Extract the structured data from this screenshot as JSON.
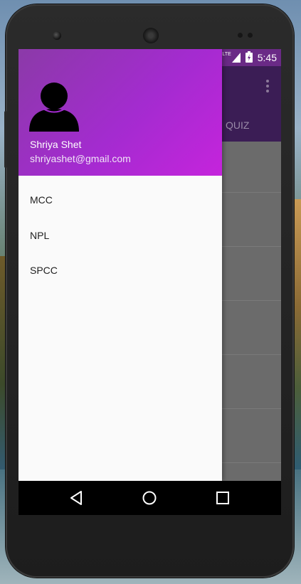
{
  "status_bar": {
    "left_icons": [
      "warning-icon",
      "download-icon",
      "download-icon",
      "download-icon",
      "android-icon"
    ],
    "network_label": "LTE",
    "time": "5:45"
  },
  "app_bar": {
    "visible_tab": "QUIZ",
    "overflow_icon": "more-vert-icon",
    "color": "#3b1d55"
  },
  "drawer": {
    "header": {
      "avatar_icon": "person-icon",
      "name": "Shriya Shet",
      "email": "shriyashet@gmail.com",
      "gradient_start": "#8b3aa8",
      "gradient_end": "#c524dc"
    },
    "items": [
      {
        "label": "MCC"
      },
      {
        "label": "NPL"
      },
      {
        "label": "SPCC"
      }
    ]
  },
  "nav_bar": {
    "buttons": [
      "back-icon",
      "home-icon",
      "recents-icon"
    ]
  }
}
